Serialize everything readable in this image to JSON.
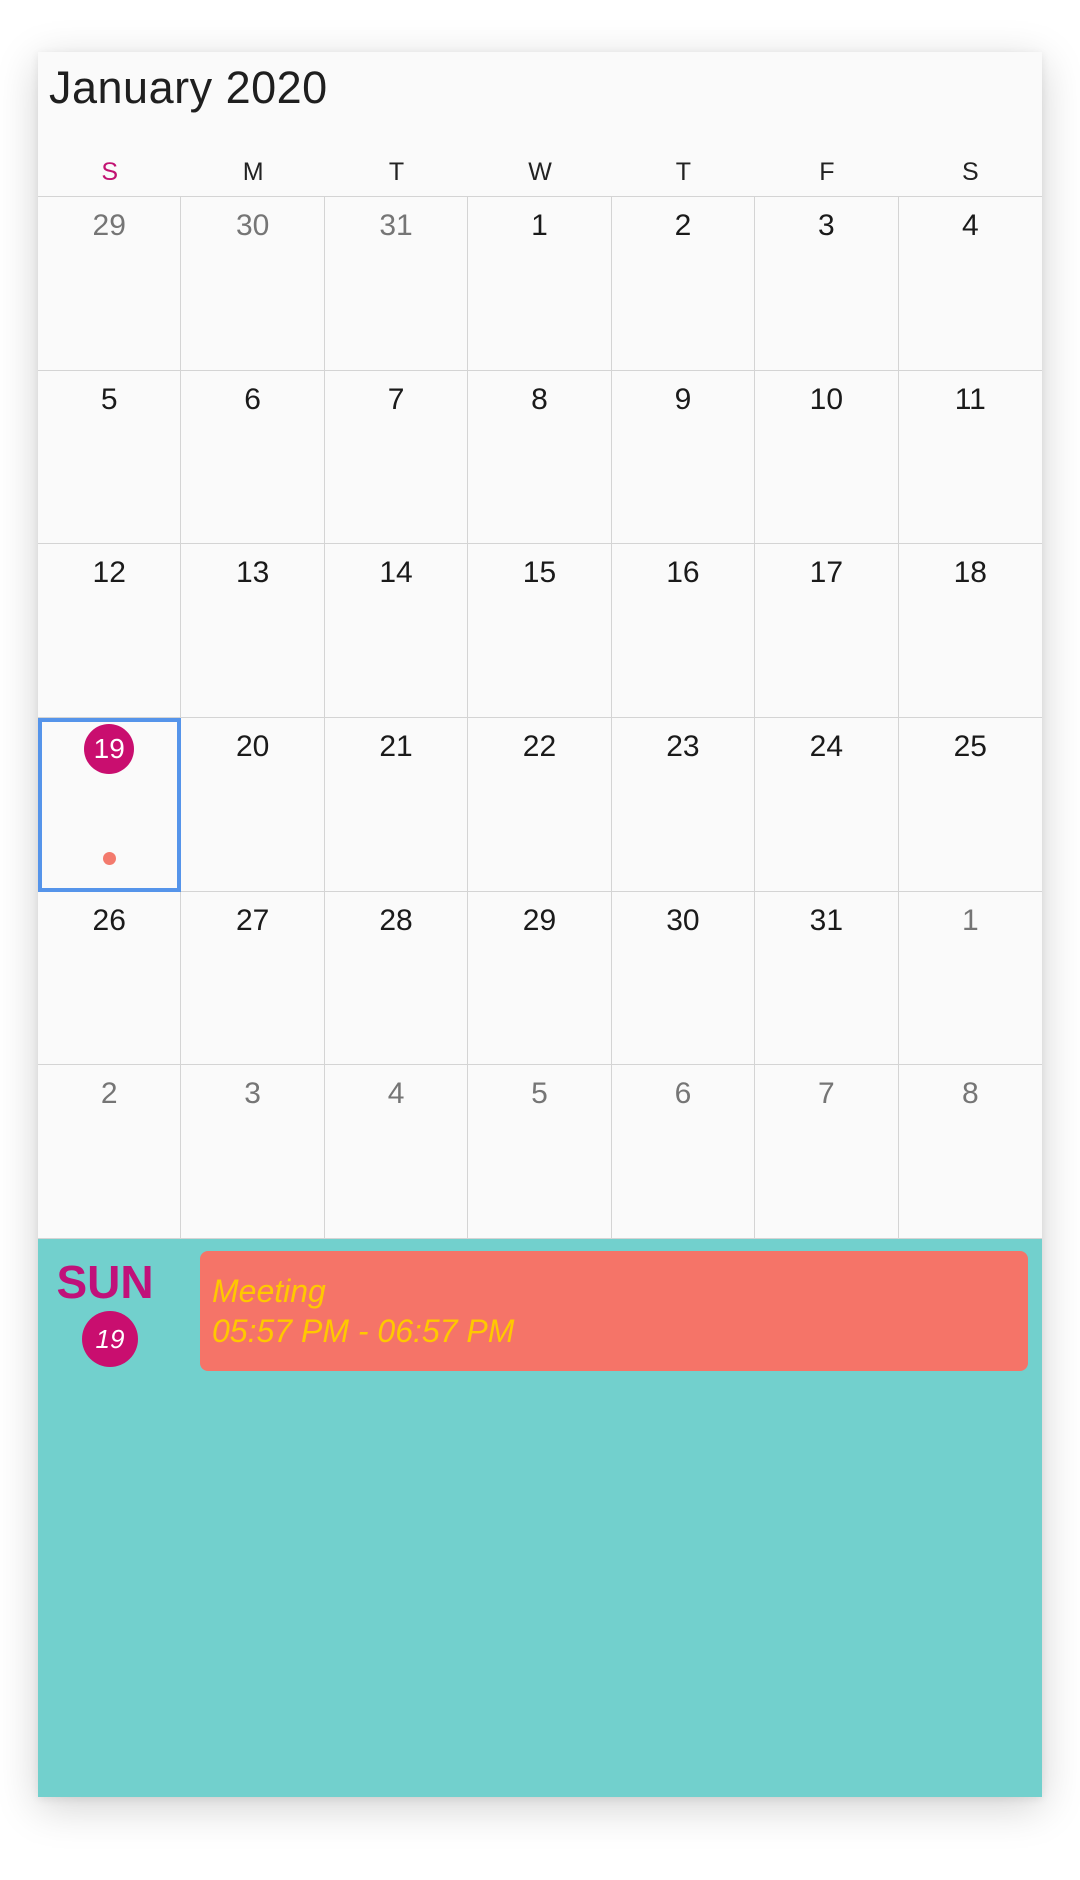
{
  "header": {
    "title": "January 2020"
  },
  "weekdays": [
    "S",
    "M",
    "T",
    "W",
    "T",
    "F",
    "S"
  ],
  "weeks": [
    [
      {
        "d": "29",
        "muted": true
      },
      {
        "d": "30",
        "muted": true
      },
      {
        "d": "31",
        "muted": true
      },
      {
        "d": "1"
      },
      {
        "d": "2"
      },
      {
        "d": "3"
      },
      {
        "d": "4"
      }
    ],
    [
      {
        "d": "5"
      },
      {
        "d": "6"
      },
      {
        "d": "7"
      },
      {
        "d": "8"
      },
      {
        "d": "9"
      },
      {
        "d": "10"
      },
      {
        "d": "11"
      }
    ],
    [
      {
        "d": "12"
      },
      {
        "d": "13"
      },
      {
        "d": "14"
      },
      {
        "d": "15"
      },
      {
        "d": "16"
      },
      {
        "d": "17"
      },
      {
        "d": "18"
      }
    ],
    [
      {
        "d": "19",
        "today": true,
        "selected": true,
        "has_event": true
      },
      {
        "d": "20"
      },
      {
        "d": "21"
      },
      {
        "d": "22"
      },
      {
        "d": "23"
      },
      {
        "d": "24"
      },
      {
        "d": "25"
      }
    ],
    [
      {
        "d": "26"
      },
      {
        "d": "27"
      },
      {
        "d": "28"
      },
      {
        "d": "29"
      },
      {
        "d": "30"
      },
      {
        "d": "31"
      },
      {
        "d": "1",
        "muted": true
      }
    ],
    [
      {
        "d": "2",
        "muted": true
      },
      {
        "d": "3",
        "muted": true
      },
      {
        "d": "4",
        "muted": true
      },
      {
        "d": "5",
        "muted": true
      },
      {
        "d": "6",
        "muted": true
      },
      {
        "d": "7",
        "muted": true
      },
      {
        "d": "8",
        "muted": true
      }
    ]
  ],
  "agenda": {
    "day_label": "SUN",
    "date_label": "19",
    "appointments": [
      {
        "subject": "Meeting",
        "time": "05:57 PM - 06:57 PM",
        "color": "#f57468",
        "text_color": "#ffc800"
      }
    ]
  },
  "colors": {
    "accent": "#c90e6f",
    "selection": "#5594ea",
    "agenda_background": "#72d0cd",
    "event_dot": "#f37a6d"
  }
}
